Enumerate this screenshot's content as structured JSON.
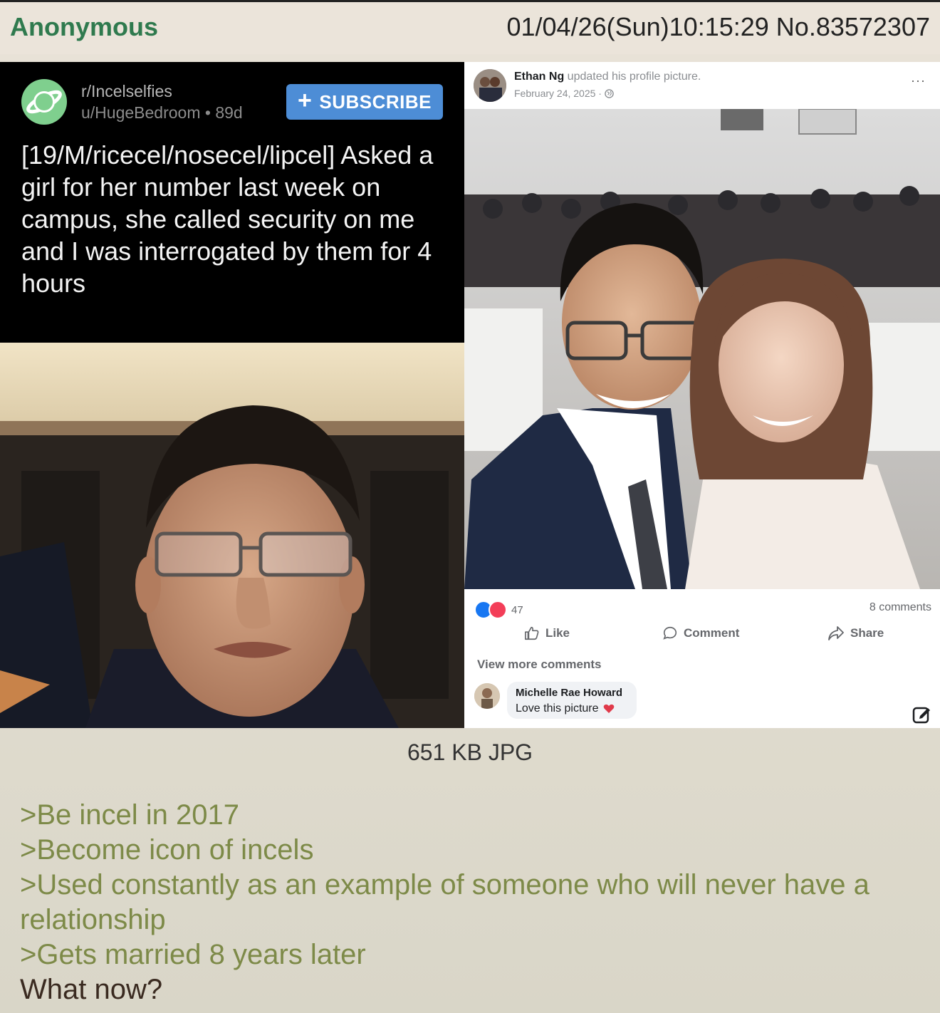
{
  "post": {
    "author": "Anonymous",
    "datetime": "01/04/26(Sun)10:15:29",
    "post_number": "No.83572307",
    "file_info": "651 KB JPG"
  },
  "reddit": {
    "subreddit": "r/Incelselfies",
    "user_meta": "u/HugeBedroom • 89d",
    "subscribe_label": "SUBSCRIBE",
    "title": "[19/M/ricecel/nosecel/lipcel] Asked a girl for her number last week on campus, she called security on me and I was interrogated by them for 4 hours"
  },
  "facebook": {
    "name": "Ethan Ng",
    "action": " updated his profile picture.",
    "date": "February 24, 2025 · ",
    "more": "···",
    "reaction_count": "47",
    "comment_count": "8 comments",
    "like_label": "Like",
    "comment_label": "Comment",
    "share_label": "Share",
    "view_more": "View more comments",
    "commenter": "Michelle Rae Howard",
    "comment_text": "Love this picture"
  },
  "greentext": [
    ">Be incel in 2017",
    ">Become icon of incels",
    ">Used constantly as an example of someone who will never have a relationship",
    ">Gets married 8 years later",
    "What now?"
  ],
  "colors": {
    "poster_name": "#2f7a4e",
    "greentext": "#7d8a48",
    "subscribe_button": "#4d8dd6",
    "facebook_blue": "#1877f2"
  }
}
